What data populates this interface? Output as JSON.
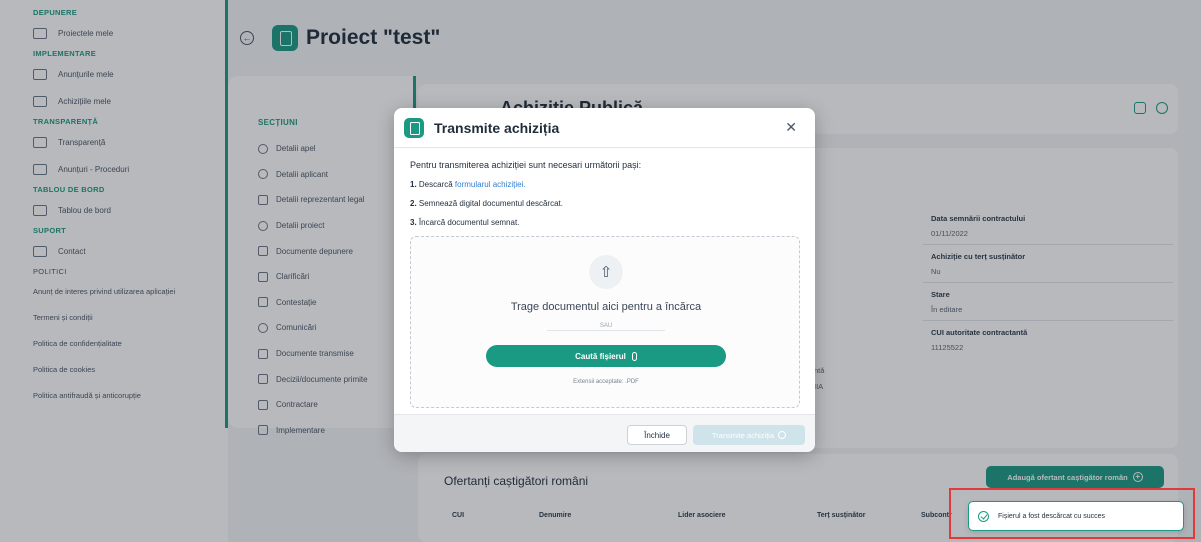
{
  "sidebar": {
    "groups": [
      {
        "title": "DEPUNERE",
        "items": [
          {
            "label": "Proiectele mele",
            "icon": "clipboard-icon"
          }
        ]
      },
      {
        "title": "IMPLEMENTARE",
        "items": [
          {
            "label": "Anunțurile mele",
            "icon": "folder-icon"
          },
          {
            "label": "Achizițiile mele",
            "icon": "document-icon"
          }
        ]
      },
      {
        "title": "TRANSPARENȚĂ",
        "items": [
          {
            "label": "Transparență",
            "icon": "table-icon"
          },
          {
            "label": "Anunțuri - Proceduri",
            "icon": "copy-icon"
          }
        ]
      },
      {
        "title": "TABLOU DE BORD",
        "items": [
          {
            "label": "Tablou de bord",
            "icon": "dashboard-icon"
          }
        ]
      },
      {
        "title": "SUPORT",
        "items": [
          {
            "label": "Contact",
            "icon": "mail-icon"
          }
        ]
      }
    ],
    "policies_title": "POLITICI",
    "policies": [
      "Anunț de interes privind utilizarea aplicației",
      "Termeni și condiții",
      "Politica de confidențialitate",
      "Politica de cookies",
      "Politica antifraudă și anticorupție"
    ]
  },
  "header": {
    "title": "Proiect \"test\""
  },
  "sections": {
    "title": "SECȚIUNI",
    "items": [
      "Detalii apel",
      "Detalii aplicant",
      "Detalii reprezentant legal",
      "Detalii proiect",
      "Documente depunere",
      "Clarificări",
      "Contestație",
      "Comunicări",
      "Documente transmise",
      "Decizii/documente primite",
      "Contractare",
      "Implementare"
    ]
  },
  "main": {
    "title": "Achiziție Publică",
    "fields": [
      {
        "label": "Data semnării contractului",
        "value": "01/11/2022"
      },
      {
        "label": "Achiziție cu terț susținător",
        "value": "Nu"
      },
      {
        "label": "Stare",
        "value": "În editare"
      },
      {
        "label": "CUI autoritate contractantă",
        "value": "11125522"
      }
    ],
    "partial_text_1": "ntă",
    "partial_text_2": "IIA",
    "winners_title": "Ofertanți caștigători români",
    "add_winner_label": "Adaugă ofertant caștigător român",
    "table_headers": [
      "CUI",
      "Denumire",
      "Lider asociere",
      "Terț susținător",
      "Subcontr"
    ]
  },
  "modal": {
    "title": "Transmite achiziția",
    "intro": "Pentru transmiterea achiziției sunt necesari următorii pași:",
    "steps": [
      {
        "num": "1.",
        "text": "Descarcă ",
        "link": "formularul achiziției."
      },
      {
        "num": "2.",
        "text": "Semnează digital documentul descărcat.",
        "link": ""
      },
      {
        "num": "3.",
        "text": "Încarcă documentul semnat.",
        "link": ""
      }
    ],
    "dropzone_text": "Trage documentul aici pentru a încărca",
    "or_text": "SAU",
    "browse_label": "Caută fișierul",
    "extensions_text": "Extensii acceptate: .PDF",
    "close_label": "Închide",
    "submit_label": "Transmite achiziția"
  },
  "toast": {
    "message": "Fișierul a fost descărcat cu succes"
  },
  "colors": {
    "accent": "#1a9a82",
    "link": "#2f7fd6",
    "highlight_frame": "#e03a3a"
  }
}
